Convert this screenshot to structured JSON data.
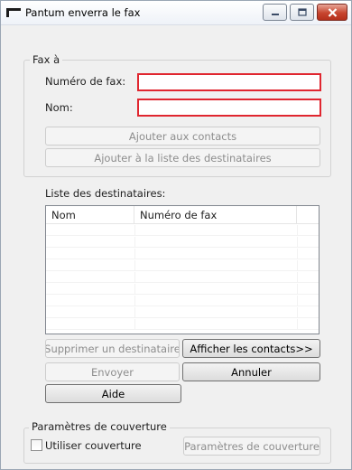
{
  "window": {
    "title": "Pantum enverra le fax",
    "buttons": [
      "minimize",
      "maximize",
      "close"
    ]
  },
  "fax_to": {
    "group_label": "Fax à",
    "fax_number_label": "Numéro de fax:",
    "fax_number_value": "",
    "name_label": "Nom:",
    "name_value": "",
    "add_contacts_button": "Ajouter aux contacts",
    "add_recipients_button": "Ajouter à la liste des destinataires"
  },
  "recipients": {
    "label": "Liste des destinataires:",
    "columns": [
      "Nom",
      "Numéro de fax"
    ],
    "rows": []
  },
  "actions": {
    "remove_recipient": "Supprimer un destinataire",
    "show_contacts": "Afficher les contacts>>",
    "send": "Envoyer",
    "cancel": "Annuler",
    "help": "Aide"
  },
  "cover": {
    "group_label": "Paramètres de couverture",
    "use_cover_label": "Utiliser couverture",
    "use_cover_checked": false,
    "cover_settings_button": "Paramètres de couverture"
  },
  "colors": {
    "required_field_border": "#e0262f",
    "close_button": "#c7452f"
  }
}
